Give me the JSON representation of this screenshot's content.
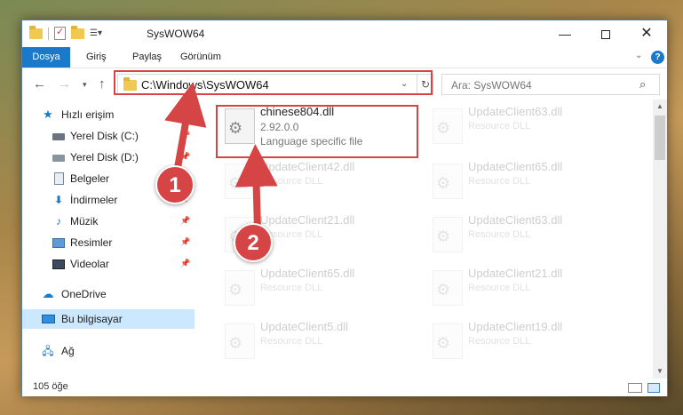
{
  "window": {
    "title": "SysWOW64",
    "minimize_glyph": "—",
    "close_glyph": "✕"
  },
  "ribbon": {
    "tabs": [
      "Dosya",
      "Giriş",
      "Paylaş",
      "Görünüm"
    ],
    "help_glyph": "?"
  },
  "nav": {
    "address": "C:\\Windows\\SysWOW64",
    "search_placeholder": "Ara: SysWOW64"
  },
  "sidebar": {
    "items": [
      {
        "label": "Hızlı erişim",
        "icon": "star-icon"
      },
      {
        "label": "Yerel Disk (C:)",
        "icon": "drive-icon"
      },
      {
        "label": "Yerel Disk (D:)",
        "icon": "drive-icon"
      },
      {
        "label": "Belgeler",
        "icon": "documents-icon"
      },
      {
        "label": "İndirmeler",
        "icon": "download-icon"
      },
      {
        "label": "Müzik",
        "icon": "music-icon"
      },
      {
        "label": "Resimler",
        "icon": "pictures-icon"
      },
      {
        "label": "Videolar",
        "icon": "video-icon"
      },
      {
        "label": "OneDrive",
        "icon": "cloud-icon"
      },
      {
        "label": "Bu bilgisayar",
        "icon": "computer-icon"
      },
      {
        "label": "Ağ",
        "icon": "network-icon"
      }
    ]
  },
  "files": {
    "selected": {
      "name": "chinese804.dll",
      "version": "2.92.0.0",
      "description": "Language specific file"
    },
    "items": [
      {
        "name": "UpdateClient63.dll",
        "type": "Resource DLL"
      },
      {
        "name": "UpdateClient42.dll",
        "type": "Resource DLL"
      },
      {
        "name": "UpdateClient65.dll",
        "type": "Resource DLL"
      },
      {
        "name": "UpdateClient21.dll",
        "type": "Resource DLL"
      },
      {
        "name": "UpdateClient63.dll",
        "type": "Resource DLL"
      },
      {
        "name": "UpdateClient65.dll",
        "type": "Resource DLL"
      },
      {
        "name": "UpdateClient21.dll",
        "type": "Resource DLL"
      },
      {
        "name": "UpdateClient5.dll",
        "type": "Resource DLL"
      },
      {
        "name": "UpdateClient19.dll",
        "type": "Resource DLL"
      }
    ]
  },
  "status": {
    "count": "105 öğe"
  },
  "annotations": {
    "badge1": "1",
    "badge2": "2",
    "color": "#d64545"
  }
}
